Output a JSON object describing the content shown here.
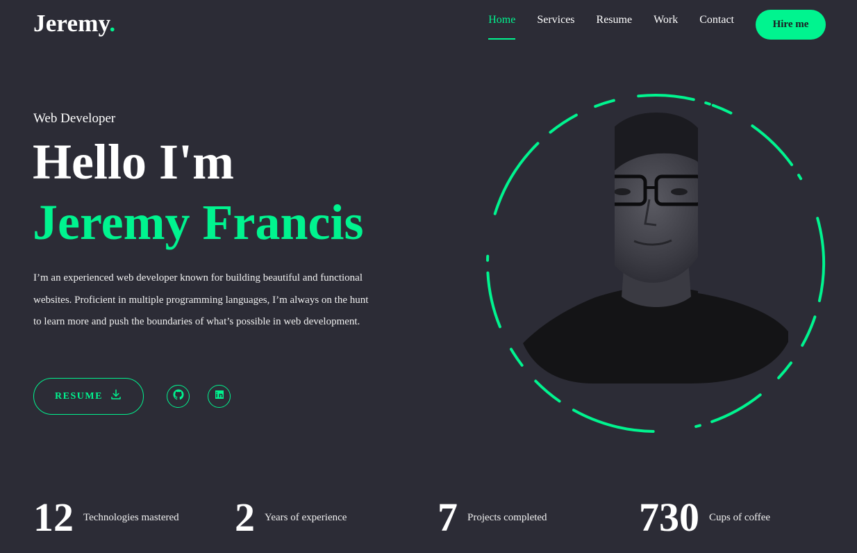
{
  "brand": {
    "name": "Jeremy",
    "dot": "."
  },
  "nav": {
    "items": [
      {
        "label": "Home",
        "active": true
      },
      {
        "label": "Services",
        "active": false
      },
      {
        "label": "Resume",
        "active": false
      },
      {
        "label": "Work",
        "active": false
      },
      {
        "label": "Contact",
        "active": false
      }
    ],
    "cta": "Hire me"
  },
  "hero": {
    "role": "Web Developer",
    "greeting": "Hello I'm",
    "name": "Jeremy Francis",
    "bio": "I’m an experienced web developer known for building beautiful and functional websites. Proficient in multiple programming languages, I’m always on the hunt to learn more and push the boundaries of what’s possible in web development.",
    "resume_button": "RESUME",
    "socials": [
      "github-icon",
      "linkedin-icon"
    ]
  },
  "stats": [
    {
      "value": "12",
      "label": "Technologies mastered"
    },
    {
      "value": "2",
      "label": "Years of experience"
    },
    {
      "value": "7",
      "label": "Projects completed"
    },
    {
      "value": "730",
      "label": "Cups of coffee"
    }
  ],
  "colors": {
    "accent": "#00f48f",
    "background": "#2c2c36",
    "text": "#ffffff"
  }
}
